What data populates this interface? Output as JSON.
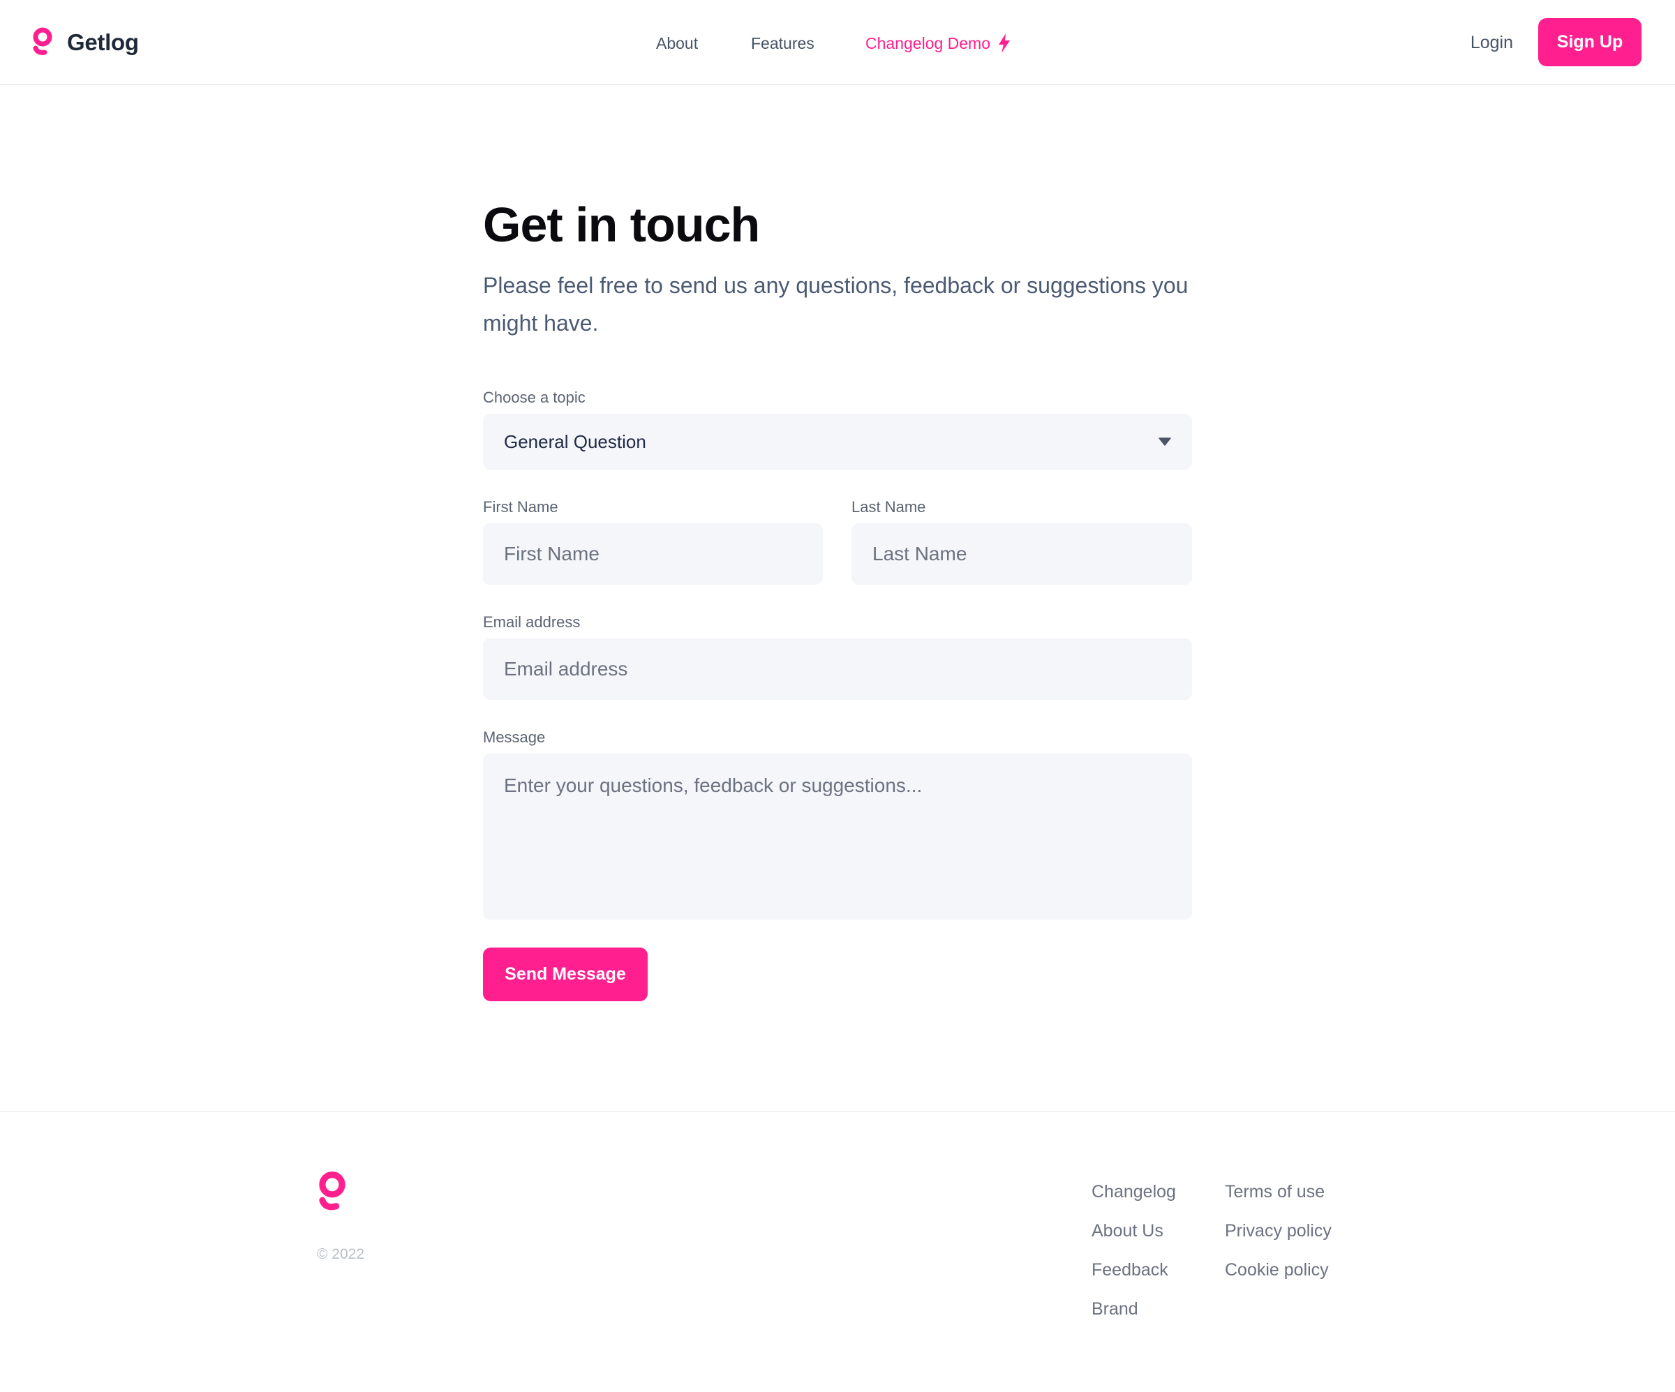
{
  "brand": {
    "name": "Getlog",
    "logo_icon": "getlog-logo-icon",
    "accent_color": "#ff1f8e"
  },
  "nav": {
    "items": [
      {
        "label": "About"
      },
      {
        "label": "Features"
      },
      {
        "label": "Changelog Demo",
        "icon": "bolt-icon"
      }
    ],
    "login_label": "Login",
    "signup_label": "Sign Up"
  },
  "main": {
    "title": "Get in touch",
    "subtitle": "Please feel free to send us any questions, feedback or suggestions you might have.",
    "topic": {
      "label": "Choose a topic",
      "value": "General Question",
      "icon": "chevron-down-icon"
    },
    "first_name": {
      "label": "First Name",
      "placeholder": "First Name",
      "value": ""
    },
    "last_name": {
      "label": "Last Name",
      "placeholder": "Last Name",
      "value": ""
    },
    "email": {
      "label": "Email address",
      "placeholder": "Email address",
      "value": ""
    },
    "message": {
      "label": "Message",
      "placeholder": "Enter your questions, feedback or suggestions...",
      "value": ""
    },
    "send_label": "Send Message"
  },
  "footer": {
    "copyright": "© 2022",
    "col1": [
      "Changelog",
      "About Us",
      "Feedback",
      "Brand"
    ],
    "col2": [
      "Terms of use",
      "Privacy policy",
      "Cookie policy"
    ]
  }
}
